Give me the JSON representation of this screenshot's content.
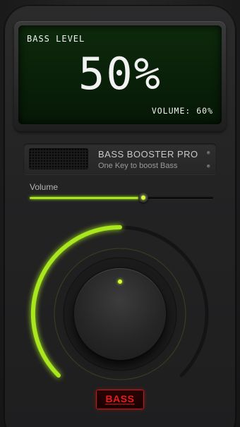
{
  "screen": {
    "label": "BASS LEVEL",
    "value": "50%",
    "volume_text": "VOLUME: 60%"
  },
  "info": {
    "title": "BASS BOOSTER PRO",
    "subtitle": "One Key to boost Bass"
  },
  "volume": {
    "label": "Volume",
    "level": 0.62
  },
  "knob": {
    "bass_level": 0.5
  },
  "bass_button": {
    "label": "BASS"
  },
  "colors": {
    "accent": "#a8e61d",
    "lcd_bg": "#0b220a",
    "bass_red": "#e81c1c"
  },
  "icons": {
    "speaker": "speaker-grille-icon",
    "screw": "screw-icon",
    "knob_dot": "knob-indicator-icon"
  }
}
